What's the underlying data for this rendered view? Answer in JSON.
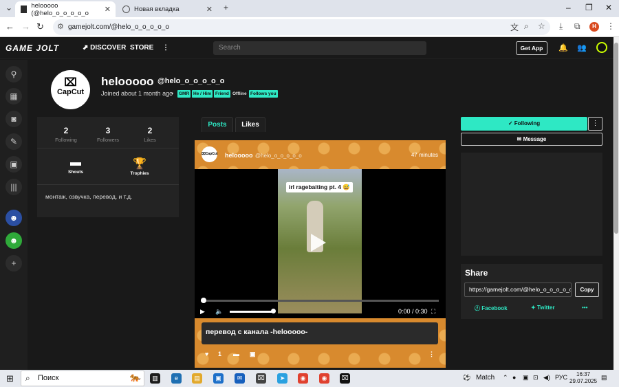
{
  "browser": {
    "tabs": [
      {
        "title": "helooooo (@helo_o_o_o_o_o",
        "active": true
      },
      {
        "title": "Новая вкладка",
        "active": false
      }
    ],
    "url": "gamejolt.com/@helo_o_o_o_o_o",
    "profile_initial": "H"
  },
  "site": {
    "logo": "GAME JOLT",
    "nav": [
      "DISCOVER",
      "STORE"
    ],
    "search_placeholder": "Search",
    "get_app": "Get App"
  },
  "profile": {
    "avatar_text": "CapCut",
    "name": "helooooo",
    "handle": "@helo_o_o_o_o_o",
    "joined": "Joined about 1 month ago",
    "tags": [
      "GMR",
      "He / Him",
      "Friend",
      "Offline",
      "Follows you"
    ],
    "stats": [
      {
        "value": "2",
        "label": "Following"
      },
      {
        "value": "3",
        "label": "Followers"
      },
      {
        "value": "2",
        "label": "Likes"
      }
    ],
    "shouts_label": "Shouts",
    "trophies_label": "Trophies",
    "bio": "монтаж, озвучка, перевод, и т.д."
  },
  "tabs": {
    "posts": "Posts",
    "likes": "Likes"
  },
  "post": {
    "author": "helooooo",
    "handle": "@helo_o_o_o_o_o",
    "time": "47 minutes",
    "video_caption": "irl ragebaiting pt. 4 😅",
    "video_time": "0:00 / 0:30",
    "video_progress": 0.0,
    "volume": 1.0,
    "text": "перевод с канала -helooooo-",
    "likes": "1"
  },
  "actions": {
    "following": "Following",
    "message": "Message"
  },
  "share": {
    "title": "Share",
    "url": "https://gamejolt.com/@helo_o_o_o_o_o",
    "copy": "Copy",
    "facebook": "Facebook",
    "twitter": "Twitter"
  },
  "taskbar": {
    "search": "Поиск",
    "weather": "Match",
    "lang": "РУС",
    "time": "16:37",
    "date": "29.07.2025"
  },
  "colors": {
    "accent": "#2ee8c4",
    "bg": "#191919",
    "post_bg": "#d88a2e"
  }
}
